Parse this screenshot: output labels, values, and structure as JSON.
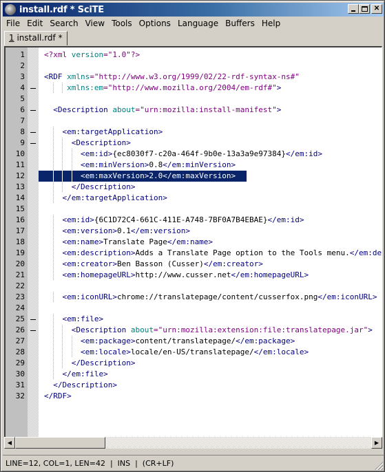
{
  "window": {
    "title": "install.rdf * SciTE",
    "buttons": {
      "minimize": "minimize",
      "maximize": "maximize",
      "close": "✕"
    }
  },
  "menu": [
    {
      "label": "File"
    },
    {
      "label": "Edit"
    },
    {
      "label": "Search"
    },
    {
      "label": "View"
    },
    {
      "label": "Tools"
    },
    {
      "label": "Options"
    },
    {
      "label": "Language"
    },
    {
      "label": "Buffers"
    },
    {
      "label": "Help"
    }
  ],
  "tabs": [
    {
      "accel": "1",
      "label": " install.rdf *",
      "active": true
    }
  ],
  "editor": {
    "selected_line": 12,
    "lines": [
      {
        "n": "1",
        "fold": false,
        "indent": 0,
        "tokens": [
          [
            "pi",
            "<?xml "
          ],
          [
            "attr",
            "version"
          ],
          [
            "str",
            "=\"1.0\""
          ],
          [
            "pi",
            "?>"
          ]
        ]
      },
      {
        "n": "2",
        "fold": false,
        "indent": 0,
        "tokens": []
      },
      {
        "n": "3",
        "fold": false,
        "indent": 0,
        "tokens": [
          [
            "tag",
            "<RDF "
          ],
          [
            "attr",
            "xmlns"
          ],
          [
            "str",
            "=\"http://www.w3.org/1999/02/22-rdf-syntax-ns#\""
          ]
        ]
      },
      {
        "n": "4",
        "fold": true,
        "indent": 0,
        "tokens": [
          [
            "plain",
            "     "
          ],
          [
            "attr",
            "xmlns:em"
          ],
          [
            "str",
            "=\"http://www.mozilla.org/2004/em-rdf#\""
          ],
          [
            "tag",
            ">"
          ]
        ]
      },
      {
        "n": "5",
        "fold": false,
        "indent": 0,
        "tokens": []
      },
      {
        "n": "6",
        "fold": true,
        "indent": 0,
        "tokens": [
          [
            "plain",
            "  "
          ],
          [
            "tag",
            "<Description "
          ],
          [
            "attr",
            "about"
          ],
          [
            "str",
            "=\"urn:mozilla:install-manifest\""
          ],
          [
            "tag",
            ">"
          ]
        ]
      },
      {
        "n": "7",
        "fold": false,
        "indent": 0,
        "tokens": []
      },
      {
        "n": "8",
        "fold": true,
        "indent": 0,
        "tokens": [
          [
            "plain",
            "    "
          ],
          [
            "tag",
            "<em:targetApplication>"
          ]
        ]
      },
      {
        "n": "9",
        "fold": true,
        "indent": 0,
        "tokens": [
          [
            "plain",
            "      "
          ],
          [
            "tag",
            "<Description>"
          ]
        ]
      },
      {
        "n": "10",
        "fold": false,
        "indent": 0,
        "tokens": [
          [
            "plain",
            "        "
          ],
          [
            "tag",
            "<em:id>"
          ],
          [
            "plain",
            "{ec8030f7-c20a-464f-9b0e-13a3a9e97384}"
          ],
          [
            "tag",
            "</em:id>"
          ]
        ]
      },
      {
        "n": "11",
        "fold": false,
        "indent": 0,
        "tokens": [
          [
            "plain",
            "        "
          ],
          [
            "tag",
            "<em:minVersion>"
          ],
          [
            "plain",
            "0.8"
          ],
          [
            "tag",
            "</em:minVersion>"
          ]
        ]
      },
      {
        "n": "12",
        "fold": false,
        "indent": 0,
        "tokens": [
          [
            "plain",
            "        "
          ],
          [
            "tag",
            "<em:maxVersion>"
          ],
          [
            "plain",
            "2.0"
          ],
          [
            "tag",
            "</em:maxVersion>"
          ]
        ]
      },
      {
        "n": "13",
        "fold": false,
        "indent": 0,
        "tokens": [
          [
            "plain",
            "      "
          ],
          [
            "tag",
            "</Description>"
          ]
        ]
      },
      {
        "n": "14",
        "fold": false,
        "indent": 0,
        "tokens": [
          [
            "plain",
            "    "
          ],
          [
            "tag",
            "</em:targetApplication>"
          ]
        ]
      },
      {
        "n": "15",
        "fold": false,
        "indent": 0,
        "tokens": []
      },
      {
        "n": "16",
        "fold": false,
        "indent": 0,
        "tokens": [
          [
            "plain",
            "    "
          ],
          [
            "tag",
            "<em:id>"
          ],
          [
            "plain",
            "{6C1D72C4-661C-411E-A748-7BF0A7B4EBAE}"
          ],
          [
            "tag",
            "</em:id>"
          ]
        ]
      },
      {
        "n": "17",
        "fold": false,
        "indent": 0,
        "tokens": [
          [
            "plain",
            "    "
          ],
          [
            "tag",
            "<em:version>"
          ],
          [
            "plain",
            "0.1"
          ],
          [
            "tag",
            "</em:version>"
          ]
        ]
      },
      {
        "n": "18",
        "fold": false,
        "indent": 0,
        "tokens": [
          [
            "plain",
            "    "
          ],
          [
            "tag",
            "<em:name>"
          ],
          [
            "plain",
            "Translate Page"
          ],
          [
            "tag",
            "</em:name>"
          ]
        ]
      },
      {
        "n": "19",
        "fold": false,
        "indent": 0,
        "tokens": [
          [
            "plain",
            "    "
          ],
          [
            "tag",
            "<em:description>"
          ],
          [
            "plain",
            "Adds a Translate Page option to the Tools menu."
          ],
          [
            "tag",
            "</em:description>"
          ]
        ]
      },
      {
        "n": "20",
        "fold": false,
        "indent": 0,
        "tokens": [
          [
            "plain",
            "    "
          ],
          [
            "tag",
            "<em:creator>"
          ],
          [
            "plain",
            "Ben Basson (Cusser)"
          ],
          [
            "tag",
            "</em:creator>"
          ]
        ]
      },
      {
        "n": "21",
        "fold": false,
        "indent": 0,
        "tokens": [
          [
            "plain",
            "    "
          ],
          [
            "tag",
            "<em:homepageURL>"
          ],
          [
            "plain",
            "http://www.cusser.net"
          ],
          [
            "tag",
            "</em:homepageURL>"
          ]
        ]
      },
      {
        "n": "22",
        "fold": false,
        "indent": 0,
        "tokens": []
      },
      {
        "n": "23",
        "fold": false,
        "indent": 0,
        "tokens": [
          [
            "plain",
            "    "
          ],
          [
            "tag",
            "<em:iconURL>"
          ],
          [
            "plain",
            "chrome://translatepage/content/cusserfox.png"
          ],
          [
            "tag",
            "</em:iconURL>"
          ]
        ]
      },
      {
        "n": "24",
        "fold": false,
        "indent": 0,
        "tokens": []
      },
      {
        "n": "25",
        "fold": true,
        "indent": 0,
        "tokens": [
          [
            "plain",
            "    "
          ],
          [
            "tag",
            "<em:file>"
          ]
        ]
      },
      {
        "n": "26",
        "fold": true,
        "indent": 0,
        "tokens": [
          [
            "plain",
            "      "
          ],
          [
            "tag",
            "<Description "
          ],
          [
            "attr",
            "about"
          ],
          [
            "str",
            "=\"urn:mozilla:extension:file:translatepage.jar\""
          ],
          [
            "tag",
            ">"
          ]
        ]
      },
      {
        "n": "27",
        "fold": false,
        "indent": 0,
        "tokens": [
          [
            "plain",
            "        "
          ],
          [
            "tag",
            "<em:package>"
          ],
          [
            "plain",
            "content/translatepage/"
          ],
          [
            "tag",
            "</em:package>"
          ]
        ]
      },
      {
        "n": "28",
        "fold": false,
        "indent": 0,
        "tokens": [
          [
            "plain",
            "        "
          ],
          [
            "tag",
            "<em:locale>"
          ],
          [
            "plain",
            "locale/en-US/translatepage/"
          ],
          [
            "tag",
            "</em:locale>"
          ]
        ]
      },
      {
        "n": "29",
        "fold": false,
        "indent": 0,
        "tokens": [
          [
            "plain",
            "      "
          ],
          [
            "tag",
            "</Description>"
          ]
        ]
      },
      {
        "n": "30",
        "fold": false,
        "indent": 0,
        "tokens": [
          [
            "plain",
            "    "
          ],
          [
            "tag",
            "</em:file>"
          ]
        ]
      },
      {
        "n": "31",
        "fold": false,
        "indent": 0,
        "tokens": [
          [
            "plain",
            "  "
          ],
          [
            "tag",
            "</Description>"
          ]
        ]
      },
      {
        "n": "32",
        "fold": false,
        "indent": 0,
        "tokens": [
          [
            "tag",
            "</RDF>"
          ]
        ]
      }
    ]
  },
  "scrollbar": {
    "left_arrow": "◀",
    "right_arrow": "▶"
  },
  "status": {
    "text": "LINE=12, COL=1, LEN=42  |  INS  |  (CR+LF)"
  }
}
